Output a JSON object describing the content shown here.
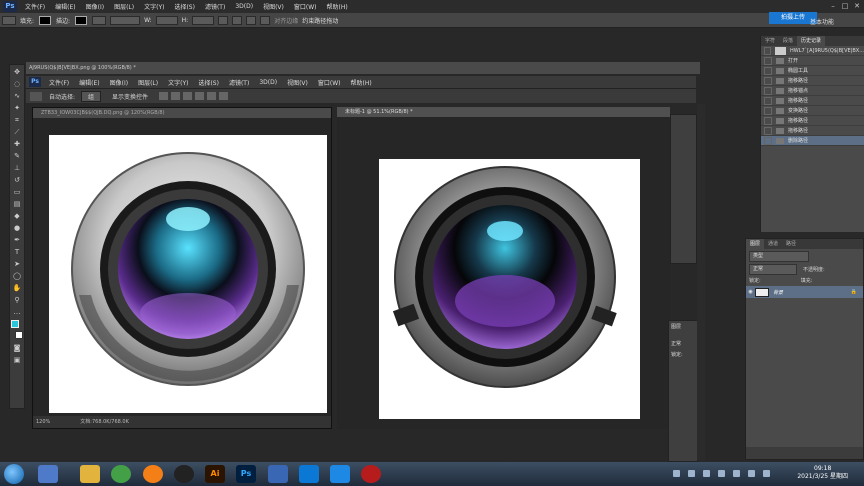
{
  "app": {
    "logo": "Ps",
    "brand_color": "#1b2a4a"
  },
  "menu": [
    "文件(F)",
    "编辑(E)",
    "图像(I)",
    "图层(L)",
    "文字(Y)",
    "选择(S)",
    "滤镜(T)",
    "3D(D)",
    "视图(V)",
    "窗口(W)",
    "帮助(H)"
  ],
  "options": {
    "fill_label": "填充:",
    "stroke_label": "描边:",
    "w_label": "W:",
    "h_label": "H:",
    "align_edges": "对齐边缘",
    "constrain_path": "约束路径拖动"
  },
  "upload_button": "拍摄上传",
  "workspace": "基本功能",
  "window2": {
    "title": "AJ9RUS(Q$|B[VE|BX.png @ 100%(RGB/8) *",
    "menu": [
      "文件(F)",
      "编辑(E)",
      "图像(I)",
      "图层(L)",
      "文字(Y)",
      "选择(S)",
      "滤镜(T)",
      "3D(D)",
      "视图(V)",
      "窗口(W)",
      "帮助(H)"
    ],
    "auto_select": "自动选择:",
    "auto_select_value": "组",
    "show_transform": "显示变换控件"
  },
  "doc1": {
    "title": "ZTB33_IOW03CJB$$(QJB.DQ.png @ 120%(RGB/8)",
    "zoom": "120%",
    "status": "文档:768.0K/768.0K"
  },
  "doc2": {
    "title": "未标题-1 @ 51.1%(RGB/8) *"
  },
  "history": {
    "tabs": [
      "字符",
      "段落",
      "历史记录"
    ],
    "snapshot": "HWL7`[A]9RU5(Q$|B[VE|BX...",
    "items": [
      "打开",
      "椭圆工具",
      "拖移路径",
      "拖移锚点",
      "拖移路径",
      "变换路径",
      "拖移路径",
      "拖移路径",
      "删除路径"
    ],
    "selected_index": 8
  },
  "layers": {
    "tabs": [
      "图层",
      "通道",
      "路径"
    ],
    "kind": "类型",
    "blend": "正常",
    "opacity_label": "不透明度:",
    "lock_label": "锁定:",
    "fill_label": "填充:",
    "layer_name": "背景"
  },
  "layers_small": {
    "tab": "图层",
    "blend": "正常",
    "lock": "锁定:"
  },
  "taskbar": {
    "apps": [
      "Ai",
      "Ps"
    ],
    "time": "09:18",
    "date": "2021/3/25 星期四"
  }
}
